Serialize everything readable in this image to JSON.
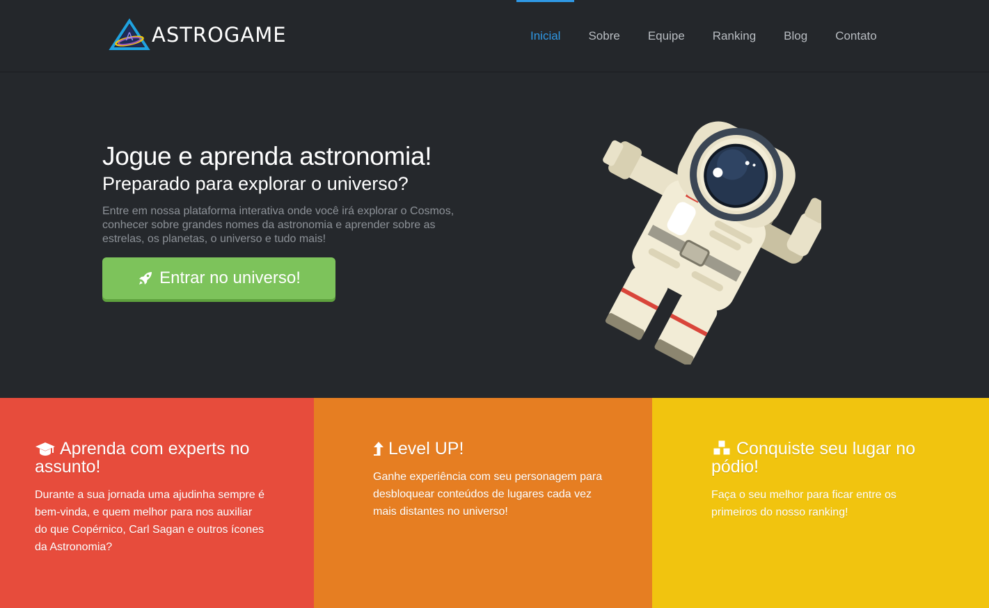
{
  "brand": {
    "name": "ASTROGAME"
  },
  "nav": {
    "items": [
      {
        "label": "Inicial",
        "active": true
      },
      {
        "label": "Sobre",
        "active": false
      },
      {
        "label": "Equipe",
        "active": false
      },
      {
        "label": "Ranking",
        "active": false
      },
      {
        "label": "Blog",
        "active": false
      },
      {
        "label": "Contato",
        "active": false
      }
    ]
  },
  "hero": {
    "title": "Jogue e aprenda astronomia!",
    "subtitle": "Preparado para explorar o universo?",
    "text": "Entre em nossa plataforma interativa onde você irá explorar o Cosmos, conhecer sobre grandes nomes da astronomia e aprender sobre as estrelas, os planetas, o universo e tudo mais!",
    "cta_label": "Entrar no universo!",
    "cta_icon": "rocket-icon"
  },
  "features": [
    {
      "icon": "graduation-cap-icon",
      "title": "Aprenda com experts no assunto!",
      "text": "Durante a sua jornada uma ajudinha sempre é bem-vinda, e quem melhor para nos auxiliar do que Copérnico, Carl Sagan e outros ícones da Astronomia?",
      "color": "#e74c3c"
    },
    {
      "icon": "level-up-icon",
      "title": "Level UP!",
      "text": "Ganhe experiência com seu personagem para desbloquear conteúdos de lugares cada vez mais distantes no universo!",
      "color": "#e67e22"
    },
    {
      "icon": "cubes-icon",
      "title": "Conquiste seu lugar no pódio!",
      "text": "Faça o seu melhor para ficar entre os primeiros do nosso ranking!",
      "color": "#f1c40f"
    }
  ],
  "colors": {
    "accent": "#2f98e5",
    "cta": "#7dc35b",
    "background": "#25282c"
  }
}
